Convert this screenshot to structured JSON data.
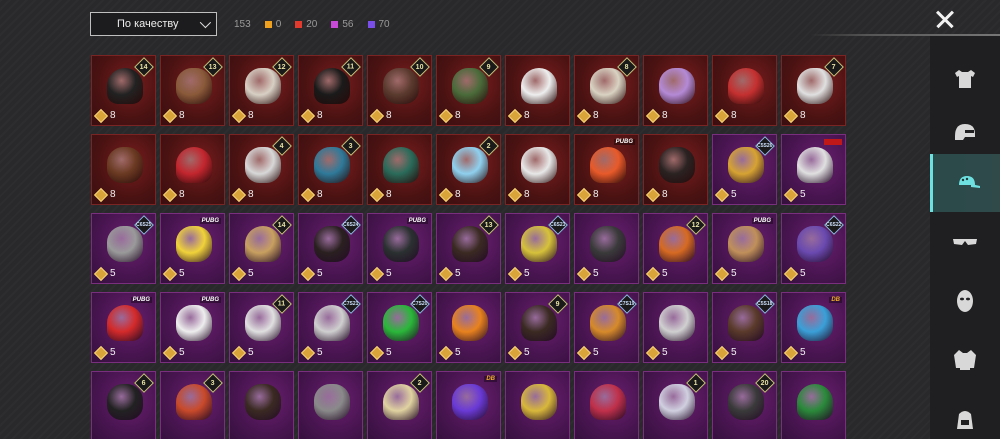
{
  "sort": {
    "label": "По качеству"
  },
  "counts": {
    "total": "153",
    "items": [
      {
        "color": "#f0a21e",
        "value": "0"
      },
      {
        "color": "#e23b2e",
        "value": "20"
      },
      {
        "color": "#c94ad9",
        "value": "56"
      },
      {
        "color": "#7a4ee8",
        "value": "70"
      }
    ]
  },
  "cards": [
    {
      "r": "red",
      "badge": "14",
      "type": "num",
      "price": "8",
      "art": "#222"
    },
    {
      "r": "red",
      "badge": "13",
      "type": "num",
      "price": "8",
      "art": "#8a5a3a"
    },
    {
      "r": "red",
      "badge": "12",
      "type": "num",
      "price": "8",
      "art": "#d8d0c4"
    },
    {
      "r": "red",
      "badge": "11",
      "type": "num",
      "price": "8",
      "art": "#1a1a1a"
    },
    {
      "r": "red",
      "badge": "10",
      "type": "num",
      "price": "8",
      "art": "#5b3a2e"
    },
    {
      "r": "red",
      "badge": "9",
      "type": "num",
      "price": "8",
      "art": "#4a6b3a"
    },
    {
      "r": "red",
      "badge": "",
      "type": "",
      "price": "8",
      "art": "#eeeeee"
    },
    {
      "r": "red",
      "badge": "8",
      "type": "num",
      "price": "8",
      "art": "#d9d2c2"
    },
    {
      "r": "red",
      "badge": "",
      "type": "",
      "price": "8",
      "art": "#b48ad6"
    },
    {
      "r": "red",
      "badge": "",
      "type": "",
      "price": "8",
      "art": "#c53030"
    },
    {
      "r": "red",
      "badge": "7",
      "type": "num",
      "price": "8",
      "art": "#e0e0e0"
    },
    {
      "r": "red",
      "badge": "",
      "type": "",
      "price": "8",
      "art": "#6b3a22"
    },
    {
      "r": "red",
      "badge": "",
      "type": "",
      "price": "8",
      "art": "#c3262e"
    },
    {
      "r": "red",
      "badge": "4",
      "type": "num",
      "price": "8",
      "art": "#d8d8d8"
    },
    {
      "r": "red",
      "badge": "3",
      "type": "num",
      "price": "8",
      "art": "#2f7a9a"
    },
    {
      "r": "red",
      "badge": "",
      "type": "",
      "price": "8",
      "art": "#2a6b5a"
    },
    {
      "r": "red",
      "badge": "2",
      "type": "num",
      "price": "8",
      "art": "#8fd0ee"
    },
    {
      "r": "red",
      "badge": "",
      "type": "",
      "price": "8",
      "art": "#e8e8e8"
    },
    {
      "r": "red",
      "badge": "PUBG",
      "type": "tag",
      "price": "8",
      "art": "#e85a2a"
    },
    {
      "r": "red",
      "badge": "",
      "type": "",
      "price": "8",
      "art": "#2a2222"
    },
    {
      "r": "purple",
      "badge": "C5S26",
      "type": "blue",
      "price": "5",
      "art": "#d6a332"
    },
    {
      "r": "purple",
      "badge": "",
      "type": "tag2",
      "price": "5",
      "art": "#e0e0e0"
    },
    {
      "r": "purple",
      "badge": "C6S25",
      "type": "blue",
      "price": "5",
      "art": "#9a9a9a"
    },
    {
      "r": "purple",
      "badge": "PUBG",
      "type": "tag",
      "price": "5",
      "art": "#f0d23a"
    },
    {
      "r": "purple",
      "badge": "14",
      "type": "num",
      "price": "5",
      "art": "#c8a060"
    },
    {
      "r": "purple",
      "badge": "C6S24",
      "type": "blue",
      "price": "5",
      "art": "#2a2020"
    },
    {
      "r": "purple",
      "badge": "PUBG",
      "type": "tag",
      "price": "5",
      "art": "#2a3030"
    },
    {
      "r": "purple",
      "badge": "13",
      "type": "num",
      "price": "5",
      "art": "#3a2a22"
    },
    {
      "r": "purple",
      "badge": "C6S23",
      "type": "blue",
      "price": "5",
      "art": "#d6c23a"
    },
    {
      "r": "purple",
      "badge": "",
      "type": "",
      "price": "5",
      "art": "#3a3a3a"
    },
    {
      "r": "purple",
      "badge": "12",
      "type": "num",
      "price": "5",
      "art": "#d66a22"
    },
    {
      "r": "purple",
      "badge": "PUBG",
      "type": "tag",
      "price": "5",
      "art": "#c0905a"
    },
    {
      "r": "purple",
      "badge": "C6S22",
      "type": "blue",
      "price": "5",
      "art": "#6a4ab0"
    },
    {
      "r": "purple",
      "badge": "PUBG",
      "type": "tag",
      "price": "5",
      "art": "#d42a2a"
    },
    {
      "r": "purple",
      "badge": "PUBG",
      "type": "tag",
      "price": "5",
      "art": "#eeeeee"
    },
    {
      "r": "purple",
      "badge": "11",
      "type": "num",
      "price": "5",
      "art": "#e0e0e0"
    },
    {
      "r": "purple",
      "badge": "C7S21",
      "type": "blue",
      "price": "5",
      "art": "#cfcfcf"
    },
    {
      "r": "purple",
      "badge": "C7S20",
      "type": "blue",
      "price": "5",
      "art": "#2ab83a"
    },
    {
      "r": "purple",
      "badge": "",
      "type": "",
      "price": "5",
      "art": "#e8821e"
    },
    {
      "r": "purple",
      "badge": "9",
      "type": "num",
      "price": "5",
      "art": "#3a2a22"
    },
    {
      "r": "purple",
      "badge": "C7S19",
      "type": "blue",
      "price": "5",
      "art": "#d68a2a"
    },
    {
      "r": "purple",
      "badge": "",
      "type": "",
      "price": "5",
      "art": "#d0d0d0"
    },
    {
      "r": "purple",
      "badge": "C5S18",
      "type": "blue",
      "price": "5",
      "art": "#5a3a2a"
    },
    {
      "r": "purple",
      "badge": "DB",
      "type": "tag3",
      "price": "5",
      "art": "#3aa0d8"
    },
    {
      "r": "purple",
      "badge": "6",
      "type": "num",
      "price": "",
      "art": "#222"
    },
    {
      "r": "purple",
      "badge": "3",
      "type": "num",
      "price": "",
      "art": "#c94a2a"
    },
    {
      "r": "purple",
      "badge": "",
      "type": "",
      "price": "",
      "art": "#3a2a22"
    },
    {
      "r": "purple",
      "badge": "",
      "type": "",
      "price": "",
      "art": "#8a8a8a"
    },
    {
      "r": "purple",
      "badge": "2",
      "type": "num",
      "price": "",
      "art": "#e0d2a0"
    },
    {
      "r": "purple",
      "badge": "DB",
      "type": "tag3",
      "price": "",
      "art": "#6a3ad6"
    },
    {
      "r": "purple",
      "badge": "",
      "type": "",
      "price": "",
      "art": "#d8b83a"
    },
    {
      "r": "purple",
      "badge": "",
      "type": "",
      "price": "",
      "art": "#c0304a"
    },
    {
      "r": "purple",
      "badge": "1",
      "type": "num",
      "price": "",
      "art": "#d0d0e0"
    },
    {
      "r": "purple",
      "badge": "20",
      "type": "num",
      "price": "",
      "art": "#3a3a3a"
    },
    {
      "r": "purple",
      "badge": "",
      "type": "",
      "price": "",
      "art": "#2a8a3a"
    }
  ],
  "sidebar": [
    {
      "name": "outfit-tab",
      "icon": "shirt-icon",
      "active": false
    },
    {
      "name": "helmet-tab",
      "icon": "helmet-icon",
      "active": false
    },
    {
      "name": "hat-tab",
      "icon": "cap-icon",
      "active": true
    },
    {
      "name": "eyewear-tab",
      "icon": "glasses-icon",
      "active": false
    },
    {
      "name": "mask-tab",
      "icon": "mask-icon",
      "active": false
    },
    {
      "name": "jacket-tab",
      "icon": "jacket-icon",
      "active": false
    },
    {
      "name": "backpack-tab",
      "icon": "backpack-icon",
      "active": false
    }
  ]
}
